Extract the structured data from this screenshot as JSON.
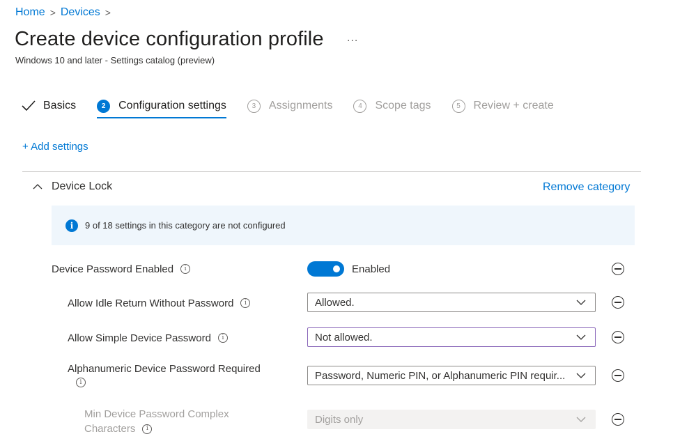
{
  "breadcrumb": {
    "home": "Home",
    "devices": "Devices",
    "separator": ">"
  },
  "page": {
    "title": "Create device configuration profile",
    "more": "...",
    "subtitle": "Windows 10 and later - Settings catalog (preview)"
  },
  "steps": [
    {
      "label": "Basics",
      "state": "done"
    },
    {
      "number": "2",
      "label": "Configuration settings",
      "state": "active"
    },
    {
      "number": "3",
      "label": "Assignments",
      "state": "disabled"
    },
    {
      "number": "4",
      "label": "Scope tags",
      "state": "disabled"
    },
    {
      "number": "5",
      "label": "Review + create",
      "state": "disabled"
    }
  ],
  "add_settings": "+ Add settings",
  "category": {
    "name": "Device Lock",
    "remove_label": "Remove category",
    "info_text": "9 of 18 settings in this category are not configured"
  },
  "settings": {
    "device_password_enabled": {
      "label": "Device Password Enabled",
      "toggle_on": true,
      "toggle_label": "Enabled"
    },
    "allow_idle_return": {
      "label": "Allow Idle Return Without Password",
      "value": "Allowed."
    },
    "allow_simple_password": {
      "label": "Allow Simple Device Password",
      "value": "Not allowed."
    },
    "alphanumeric_required": {
      "label": "Alphanumeric Device Password Required",
      "value": "Password, Numeric PIN, or Alphanumeric PIN requir..."
    },
    "min_complex_chars": {
      "label_line1": "Min Device Password Complex",
      "label_line2": "Characters",
      "value": "Digits only"
    }
  },
  "colors": {
    "accent": "#0078d4",
    "info_bg": "#eff6fc",
    "focus_border": "#8764b8"
  },
  "icons": {
    "info": "i"
  }
}
